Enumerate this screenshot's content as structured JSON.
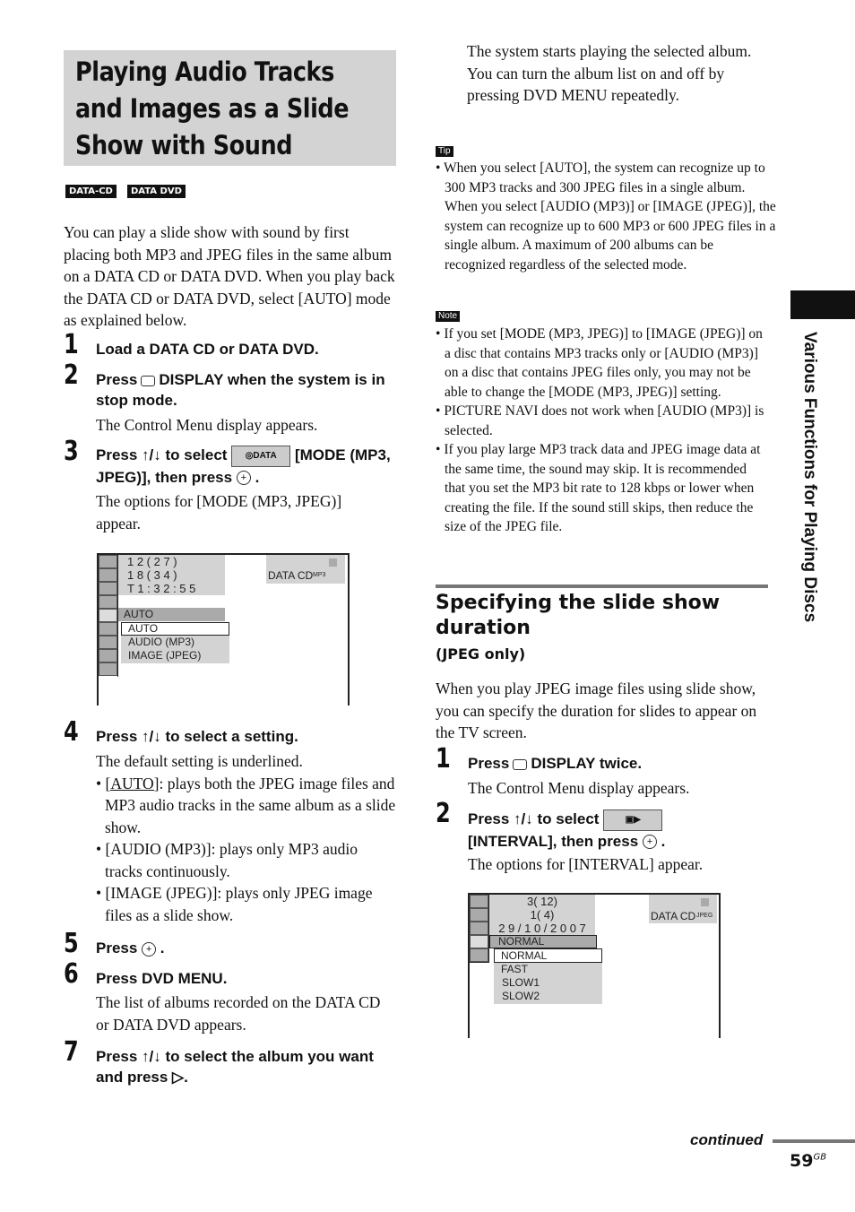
{
  "title": "Playing Audio Tracks and Images as a Slide Show with Sound",
  "badges": [
    "DATA-CD",
    "DATA DVD"
  ],
  "intro": "You can play a slide show with sound by first placing both MP3 and JPEG files in the same album on a DATA CD or DATA DVD. When you play back the DATA CD or DATA DVD, select [AUTO] mode as explained below.",
  "steps": [
    {
      "num": "1",
      "heading": "Load a DATA CD or DATA DVD."
    },
    {
      "num": "2",
      "heading_a": "Press",
      "heading_b": "DISPLAY when the system is in stop mode.",
      "text": "The Control Menu display appears."
    },
    {
      "num": "3",
      "heading_a": "Press ↑/↓ to select",
      "heading_b": "[MODE (MP3, JPEG)], then press",
      "text": "The options for [MODE (MP3, JPEG)] appear."
    },
    {
      "num": "4",
      "heading": "Press ↑/↓ to select a setting.",
      "text": "The default setting is underlined.",
      "bullets": [
        {
          "u": "[AUTO]",
          "t": ": plays both the JPEG image files and MP3 audio tracks in the same album as a slide show."
        },
        {
          "t": "[AUDIO (MP3)]: plays only MP3 audio tracks continuously."
        },
        {
          "t": "[IMAGE (JPEG)]: plays only JPEG image files as a slide show."
        }
      ]
    },
    {
      "num": "5",
      "heading": "Press"
    },
    {
      "num": "6",
      "heading": "Press DVD MENU.",
      "text": "The list of albums recorded on the DATA CD or DATA DVD appears."
    },
    {
      "num": "7",
      "heading": "Press ↑/↓ to select the album you want and press"
    }
  ],
  "screen1": {
    "lines": [
      "1 2 ( 2 7 )",
      "1 8 ( 3 4 )",
      "T      1 : 3 2 : 5 5"
    ],
    "disc": "DATA CD",
    "fmt": "MP3",
    "current": "AUTO",
    "options": [
      "AUTO",
      "AUDIO (MP3)",
      "IMAGE (JPEG)"
    ]
  },
  "right_top": [
    "The system starts playing the selected album.",
    "You can turn the album list on and off by pressing DVD MENU repeatedly."
  ],
  "tip_label": "Tip",
  "tip": "When you select [AUTO], the system can recognize up to 300 MP3 tracks and 300 JPEG files in a single album. When you select [AUDIO (MP3)] or [IMAGE (JPEG)], the system can recognize up to 600 MP3 or 600 JPEG files in a single album. A maximum of 200 albums can be recognized regardless of the selected mode.",
  "note_label": "Note",
  "notes": [
    "If you set [MODE (MP3, JPEG)] to [IMAGE (JPEG)] on a disc that contains MP3 tracks only or [AUDIO (MP3)] on a disc that contains JPEG files only, you may not be able to change the [MODE (MP3, JPEG)] setting.",
    "PICTURE NAVI does not work when [AUDIO (MP3)] is selected.",
    "If you play large MP3 track data and JPEG image data at the same time, the sound may skip. It is recommended that you set the MP3 bit rate to 128 kbps or lower when creating the file. If the sound still skips, then reduce the size of the JPEG file."
  ],
  "section2": {
    "title": "Specifying the slide show duration",
    "subtitle": "(JPEG only)",
    "intro": "When you play JPEG image files using slide show, you can specify the duration for slides to appear on the TV screen.",
    "steps": [
      {
        "num": "1",
        "heading_a": "Press",
        "heading_b": "DISPLAY twice.",
        "text": "The Control Menu display appears."
      },
      {
        "num": "2",
        "heading_a": "Press ↑/↓ to select",
        "heading_b": "[INTERVAL], then press",
        "text": "The options for [INTERVAL] appear."
      }
    ]
  },
  "screen2": {
    "lines": [
      "3(      12)",
      "1(        4)",
      "2 9 / 1 0 / 2 0 0 7"
    ],
    "disc": "DATA CD",
    "fmt": "JPEG",
    "current": "NORMAL",
    "options": [
      "NORMAL",
      "FAST",
      "SLOW1",
      "SLOW2"
    ]
  },
  "side_tab": "Various Functions for Playing Discs",
  "continued": "continued",
  "page_num": "59",
  "page_sup": "GB"
}
